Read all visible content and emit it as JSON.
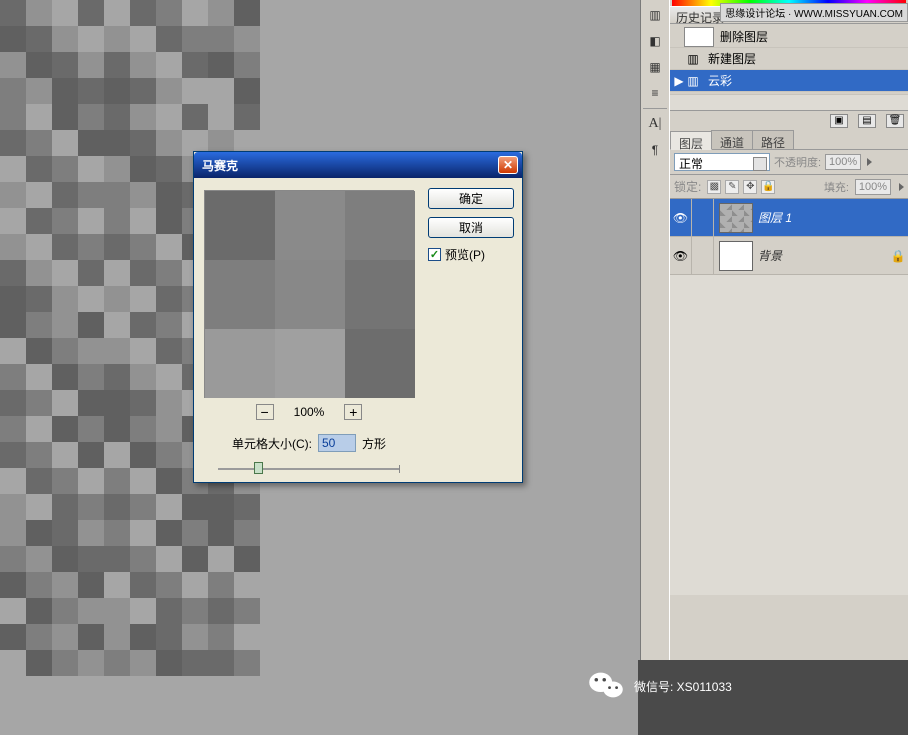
{
  "watermark_top": "思缘设计论坛 · WWW.MISSYUAN.COM",
  "history": {
    "title": "历史记录",
    "rows": [
      {
        "label": "删除图层",
        "thumb": "white"
      },
      {
        "label": "新建图层",
        "icon": "doc"
      },
      {
        "label": "云彩",
        "icon": "doc",
        "selected": true
      }
    ]
  },
  "layers_panel": {
    "tabs": [
      "图层",
      "通道",
      "路径"
    ],
    "active_tab": 0,
    "blend_label": "正常",
    "opacity_label": "不透明度:",
    "opacity_value": "100%",
    "lock_label": "锁定:",
    "fill_label": "填充:",
    "fill_value": "100%",
    "layers": [
      {
        "name": "图层 1",
        "selected": true,
        "thumb": "clouds"
      },
      {
        "name": "背景",
        "selected": false,
        "locked": true,
        "thumb": "white"
      }
    ]
  },
  "dialog": {
    "title": "马赛克",
    "ok": "确定",
    "cancel": "取消",
    "preview": "预览(P)",
    "zoom": "100%",
    "cell_label": "单元格大小(C):",
    "cell_value": "50",
    "unit": "方形"
  },
  "wechat": {
    "label": "微信号: XS011033"
  }
}
